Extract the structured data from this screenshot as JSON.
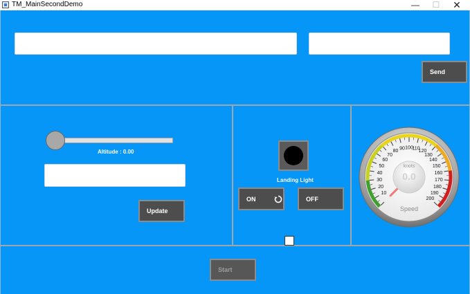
{
  "window": {
    "title": "TM_MainSecondDemo",
    "minimize_glyph": "—",
    "maximize_glyph": "☐",
    "close_glyph": "✕"
  },
  "top_panel": {
    "message_input": {
      "value": "",
      "placeholder": ""
    },
    "target_input": {
      "value": "",
      "placeholder": ""
    },
    "send_label": "Send"
  },
  "altitude_panel": {
    "slider_value": 0,
    "altitude_label": "Altitude : 0.00",
    "altitude_input": {
      "value": "",
      "placeholder": ""
    },
    "update_label": "Update"
  },
  "landing_panel": {
    "landing_light_label": "Landing Light",
    "on_label": "ON",
    "off_label": "OFF",
    "indicator_on": false,
    "checkbox_checked": false
  },
  "speed_gauge": {
    "unit": "knots",
    "value_text": "0.0",
    "title": "Speed",
    "value": 0,
    "min": 0,
    "max": 200,
    "tick_labels": [
      "10",
      "20",
      "30",
      "40",
      "50",
      "60",
      "70",
      "80",
      "90",
      "100",
      "110",
      "120",
      "130",
      "140",
      "150",
      "160",
      "170",
      "180",
      "190",
      "200"
    ]
  },
  "bottom_panel": {
    "start_label": "Start",
    "start_enabled": false
  },
  "colors": {
    "background": "#0596f7",
    "button": "#4d4d4d",
    "divider": "#9ea7b0"
  }
}
